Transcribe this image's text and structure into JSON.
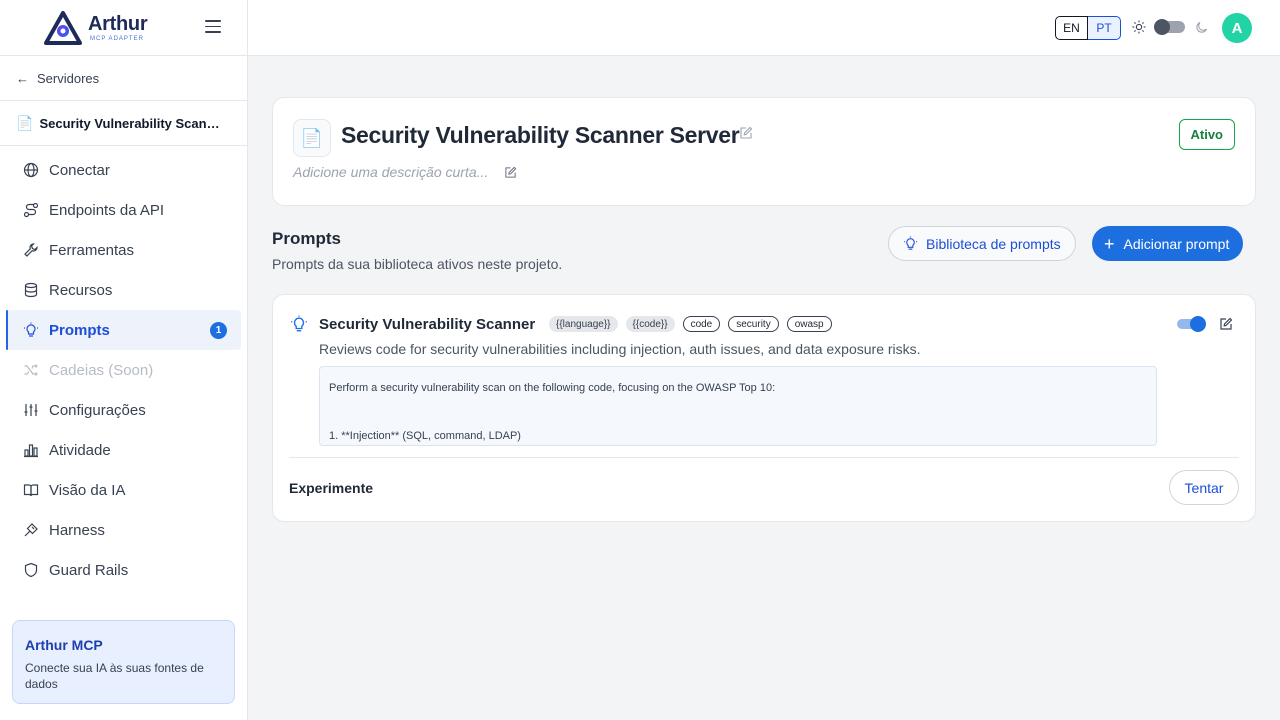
{
  "brand": {
    "name": "Arthur",
    "tagline": "MCP ADAPTER"
  },
  "sidebar": {
    "back_label": "Servidores",
    "server_name": "Security Vulnerability Scanner Server",
    "items": [
      {
        "label": "Conectar",
        "icon": "globe-icon"
      },
      {
        "label": "Endpoints da API",
        "icon": "route-icon"
      },
      {
        "label": "Ferramentas",
        "icon": "wrench-icon"
      },
      {
        "label": "Recursos",
        "icon": "database-icon"
      },
      {
        "label": "Prompts",
        "icon": "lightbulb-icon",
        "badge": "1"
      },
      {
        "label": "Cadeias (Soon)",
        "icon": "shuffle-icon"
      },
      {
        "label": "Configurações",
        "icon": "sliders-icon"
      },
      {
        "label": "Atividade",
        "icon": "bar-chart-icon"
      },
      {
        "label": "Visão da IA",
        "icon": "book-icon"
      },
      {
        "label": "Harness",
        "icon": "harness-icon"
      },
      {
        "label": "Guard Rails",
        "icon": "shield-icon"
      }
    ],
    "promo": {
      "title": "Arthur MCP",
      "text": "Conecte sua IA às suas fontes de dados"
    }
  },
  "topbar": {
    "lang_en": "EN",
    "lang_pt": "PT",
    "avatar_initial": "A"
  },
  "server": {
    "title": "Security Vulnerability Scanner Server",
    "description_placeholder": "Adicione uma descrição curta...",
    "status": "Ativo"
  },
  "prompts_section": {
    "title": "Prompts",
    "subtitle": "Prompts da sua biblioteca ativos neste projeto.",
    "library_button": "Biblioteca de prompts",
    "add_button": "Adicionar prompt"
  },
  "prompt": {
    "name": "Security Vulnerability Scanner",
    "variables": [
      "{{language}}",
      "{{code}}"
    ],
    "tags": [
      "code",
      "security",
      "owasp"
    ],
    "description": "Reviews code for security vulnerabilities including injection, auth issues, and data exposure risks.",
    "body_line1": "Perform a security vulnerability scan on the following code, focusing on the OWASP Top 10:",
    "body_line2": "1. **Injection** (SQL, command, LDAP)",
    "try_label": "Experimente",
    "try_button": "Tentar"
  }
}
